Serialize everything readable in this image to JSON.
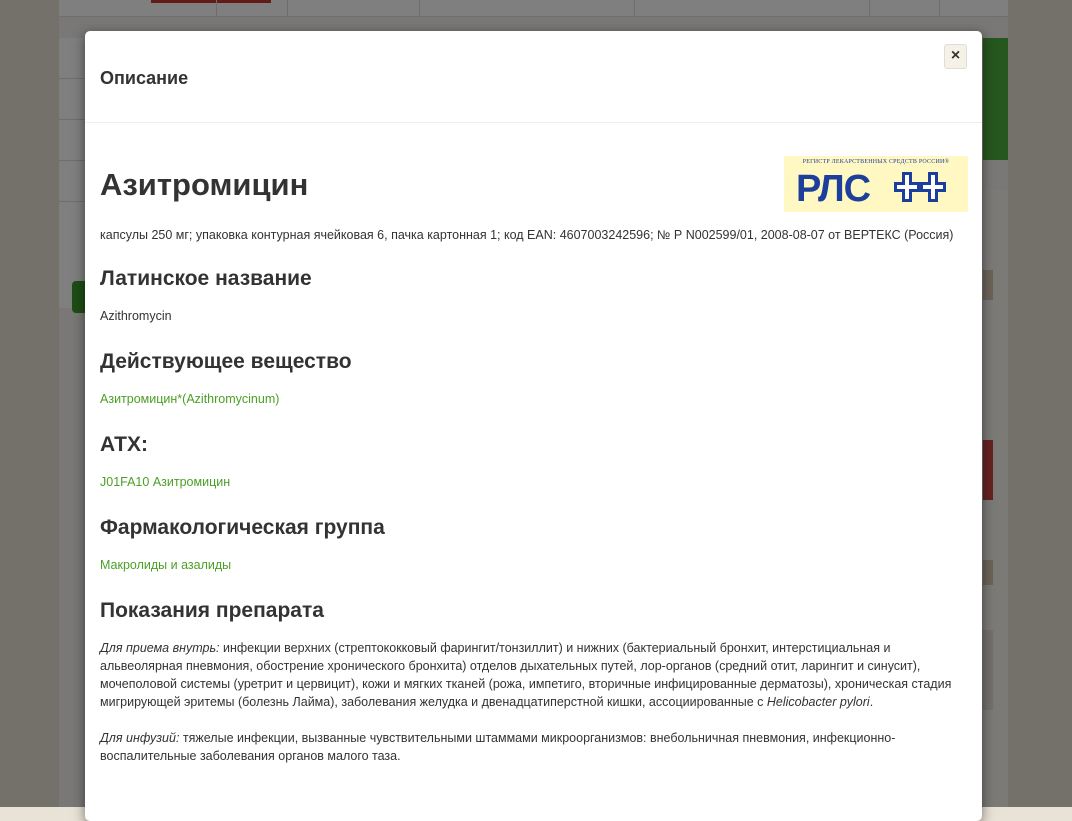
{
  "modal": {
    "title": "Описание",
    "close_label": "×"
  },
  "logo": {
    "caption": "РЕГИСТР ЛЕКАРСТВЕННЫХ СРЕДСТВ РОССИИ®",
    "text": "РЛС",
    "colors": {
      "bg": "#fff8c2",
      "fg": "#1d3f9c"
    }
  },
  "drug": {
    "name": "Азитромицин",
    "form_description": "капсулы 250 мг; упаковка контурная ячейковая 6, пачка картонная 1; код EAN: 4607003242596; № Р N002599/01, 2008-08-07 от ВЕРТЕКС (Россия)"
  },
  "sections": {
    "latin": {
      "heading": "Латинское название",
      "value": "Azithromycin"
    },
    "substance": {
      "heading": "Действующее вещество",
      "value": "Азитромицин*(Azithromycinum)"
    },
    "atc": {
      "heading": "АТХ:",
      "value": "J01FA10 Азитромицин"
    },
    "pharm_group": {
      "heading": "Фармакологическая группа",
      "value": "Макролиды и азалиды"
    },
    "indications": {
      "heading": "Показания препарата",
      "p1_label": "Для приема внутрь:",
      "p1_text": " инфекции верхних (стрептококковый фарингит/тонзиллит) и нижних (бактериальный бронхит, интерстициальная и альвеолярная пневмония, обострение хронического бронхита) отделов дыхательных путей, лор-органов (средний отит, ларингит и синусит), мочеполовой системы (уретрит и цервицит), кожи и мягких тканей (рожа, импетиго, вторичные инфицированные дерматозы), хроническая стадия мигрирующей эритемы (болезнь Лайма), заболевания желудка и двенадцатиперстной кишки, ассоциированные с ",
      "p1_italic": "Helicobacter pylori",
      "p1_end": ".",
      "p2_label": "Для инфузий:",
      "p2_text": " тяжелые инфекции, вызванные чувствительными штаммами микроорганизмов: внебольничная пневмония, инфекционно-воспалительные заболевания органов малого таза."
    }
  },
  "colors": {
    "link_green": "#4b9f25",
    "text": "#333333",
    "overlay": "rgba(0,0,0,0.5)"
  }
}
